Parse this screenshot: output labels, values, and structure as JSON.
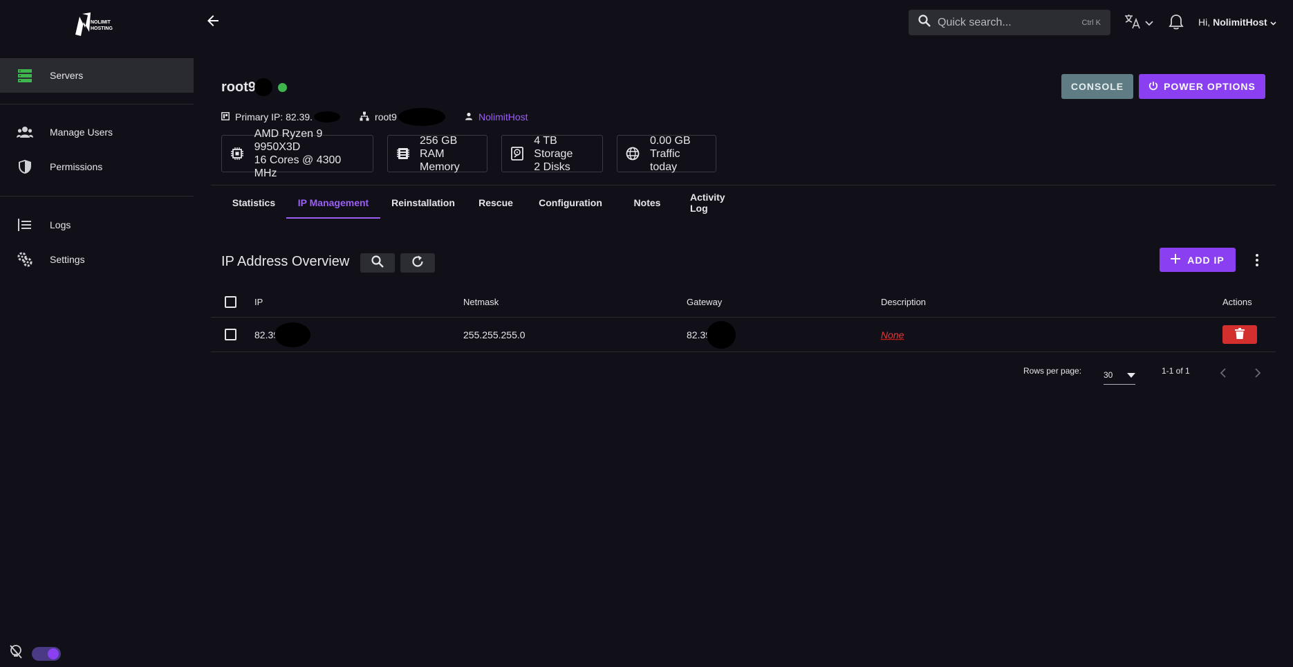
{
  "brand": {
    "logo_text": "NOLIMIT HOSTING"
  },
  "sidebar": {
    "items": [
      {
        "label": "Servers",
        "icon": "server-icon"
      },
      {
        "label": "Manage Users",
        "icon": "users-icon"
      },
      {
        "label": "Permissions",
        "icon": "shield-icon"
      },
      {
        "label": "Logs",
        "icon": "list-icon"
      },
      {
        "label": "Settings",
        "icon": "gear-icon"
      }
    ]
  },
  "topbar": {
    "search_placeholder": "Quick search...",
    "search_shortcut": "Ctrl K",
    "greeting": "Hi,",
    "username": "NolimitHost"
  },
  "server": {
    "name": "root9",
    "status_color": "#3fb54e",
    "primary_ip_label": "Primary IP: 82.39.",
    "hostname": "root9",
    "owner": "NolimitHost",
    "console_label": "CONSOLE",
    "power_label": "POWER OPTIONS",
    "specs": [
      {
        "line1": "AMD Ryzen 9 9950X3D",
        "line2": "16 Cores @ 4300 MHz",
        "icon": "cpu-icon"
      },
      {
        "line1": "256 GB RAM",
        "line2": "Memory",
        "icon": "memory-icon"
      },
      {
        "line1": "4 TB Storage",
        "line2": "2 Disks",
        "icon": "disk-icon"
      },
      {
        "line1": "0.00 GB",
        "line2": "Traffic today",
        "icon": "globe-icon"
      }
    ]
  },
  "tabs": [
    {
      "label": "Statistics"
    },
    {
      "label": "IP Management"
    },
    {
      "label": "Reinstallation"
    },
    {
      "label": "Rescue"
    },
    {
      "label": "Configuration"
    },
    {
      "label": "Notes"
    },
    {
      "label": "Activity Log"
    }
  ],
  "ip_section": {
    "title": "IP Address Overview",
    "add_label": "ADD IP",
    "columns": {
      "ip": "IP",
      "netmask": "Netmask",
      "gateway": "Gateway",
      "description": "Description",
      "actions": "Actions"
    },
    "rows": [
      {
        "ip": "82.39",
        "netmask": "255.255.255.0",
        "gateway": "82.39",
        "description": "None"
      }
    ],
    "pagination": {
      "rows_per_page_label": "Rows per page:",
      "rows_per_page": "30",
      "range": "1-1 of 1"
    }
  },
  "colors": {
    "accent": "#8a3ff0",
    "danger": "#d32f2f",
    "online": "#3fb54e"
  }
}
